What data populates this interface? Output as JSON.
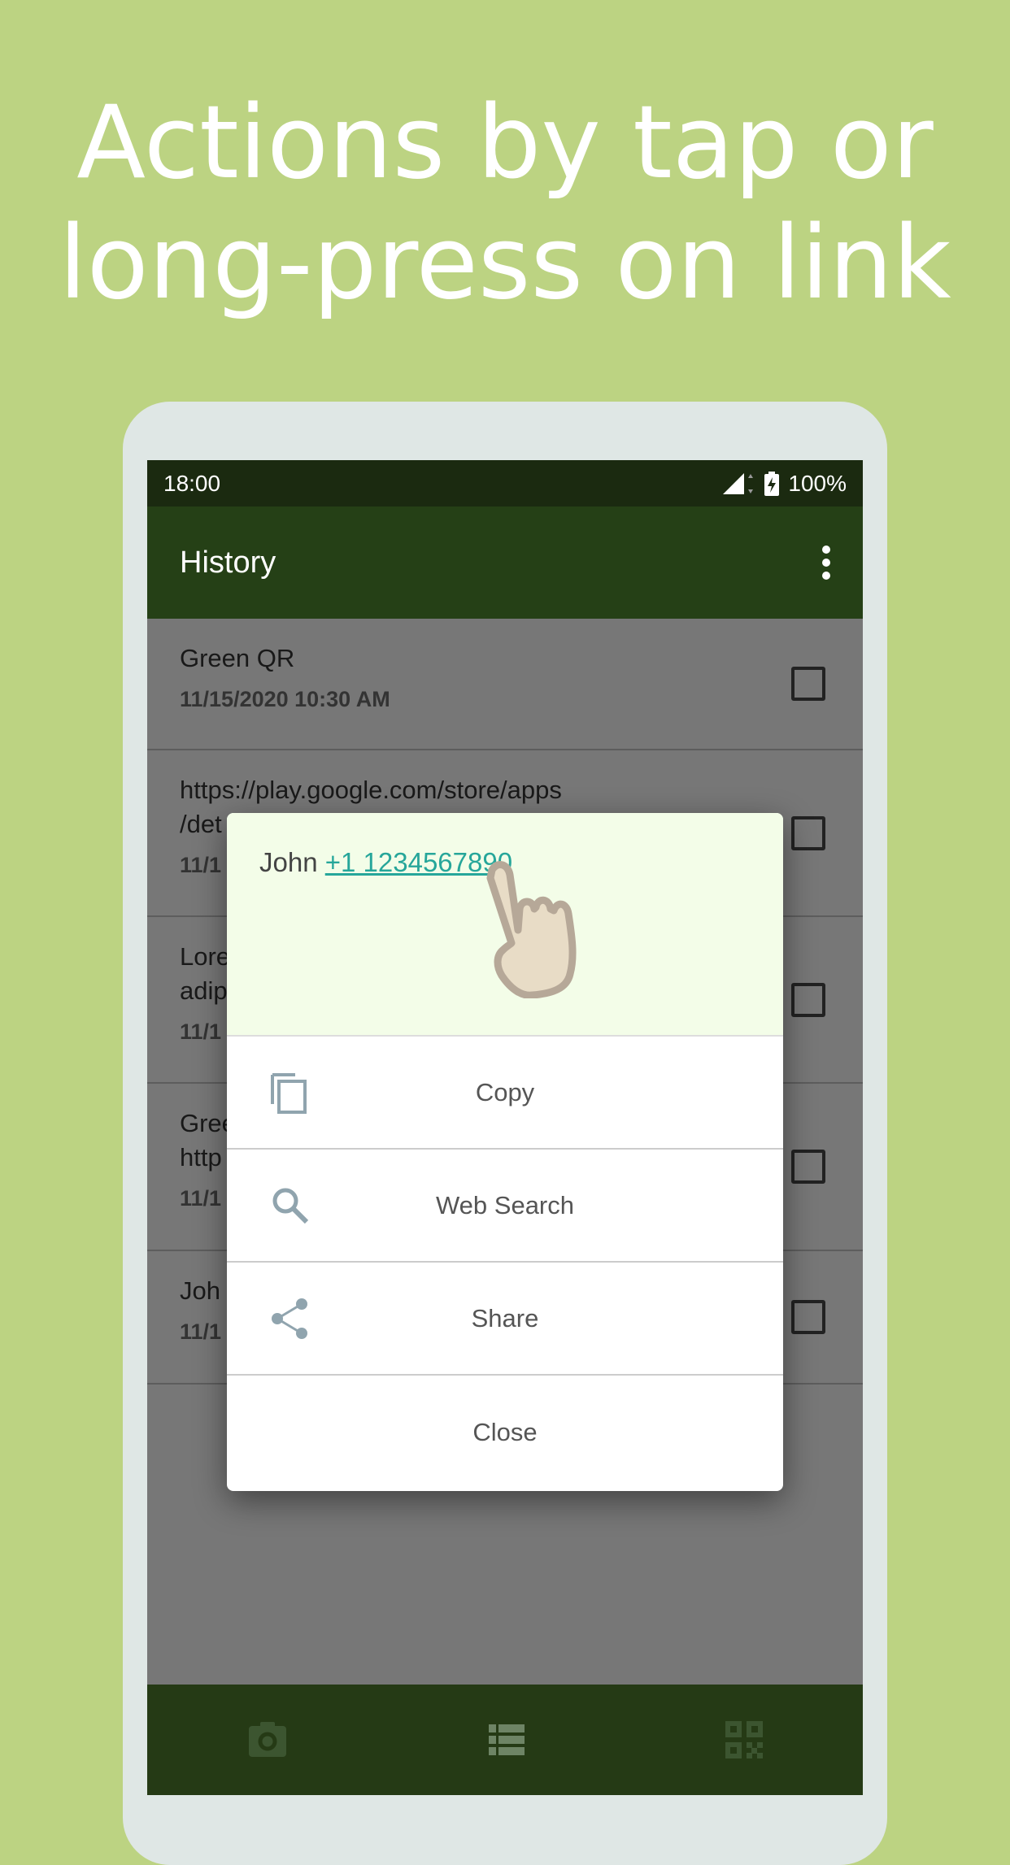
{
  "headline": {
    "line1": "Actions by tap or",
    "line2": "long-press on link"
  },
  "status": {
    "time": "18:00",
    "battery": "100%"
  },
  "appbar": {
    "title": "History",
    "menu_icon": "more-vert-icon"
  },
  "list": [
    {
      "title": "Green QR",
      "date": "11/15/2020 10:30 AM"
    },
    {
      "title": "https://play.google.com/store/apps",
      "title2": "/det",
      "date": "11/1"
    },
    {
      "title": "Lore",
      "title2": "adip",
      "date": "11/1"
    },
    {
      "title": "Gree",
      "title2": "http",
      "date": "11/1"
    },
    {
      "title": "Joh",
      "date": "11/1"
    }
  ],
  "dialog": {
    "name": "John",
    "link": "+1 1234567890",
    "items": [
      {
        "label": "Copy",
        "icon": "copy-icon"
      },
      {
        "label": "Web Search",
        "icon": "search-icon"
      },
      {
        "label": "Share",
        "icon": "share-icon"
      },
      {
        "label": "Close"
      }
    ]
  },
  "bottom_nav": [
    "camera-icon",
    "list-icon",
    "qr-code-icon"
  ],
  "colors": {
    "background": "#bcd382",
    "appbar": "#254016",
    "link": "#26a69a",
    "dialog_header": "#f3fde8"
  }
}
